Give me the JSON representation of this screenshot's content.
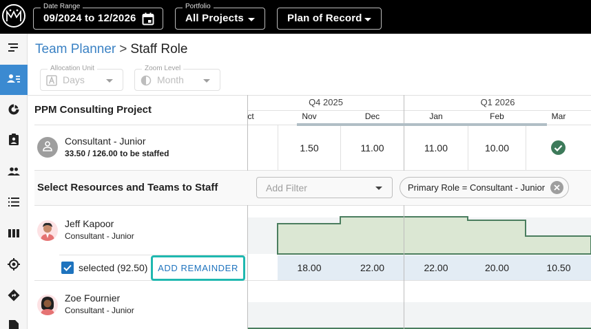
{
  "topbar": {
    "date_range": {
      "legend": "Date Range",
      "value": "09/2024 to 12/2026"
    },
    "portfolio": {
      "legend": "Portfolio",
      "value": "All Projects"
    },
    "plan": {
      "value": "Plan of Record"
    }
  },
  "header": {
    "breadcrumb_link": "Team Planner",
    "breadcrumb_sep": ">",
    "breadcrumb_current": "Staff Role"
  },
  "controls": {
    "allocation_unit": {
      "legend": "Allocation Unit",
      "value": "Days"
    },
    "zoom_level": {
      "legend": "Zoom Level",
      "value": "Month"
    }
  },
  "timeline": {
    "quarters": [
      "Q4 2025",
      "Q1 2026"
    ],
    "partial_month": "ct",
    "months": [
      "Nov",
      "Dec",
      "Jan",
      "Feb",
      "Mar"
    ]
  },
  "project": {
    "title": "PPM Consulting Project",
    "role": "Consultant - Junior",
    "staffing": "33.50 / 126.00 to be staffed",
    "values": [
      "1.50",
      "11.00",
      "11.00",
      "10.00"
    ],
    "mar_status": "check-circle-icon"
  },
  "resources": {
    "title": "Select Resources and Teams to Staff",
    "filter_placeholder": "Add Filter",
    "chip_label": "Primary Role = Consultant - Junior",
    "people": [
      {
        "name": "Jeff Kapoor",
        "role": "Consultant - Junior"
      },
      {
        "name": "Zoe Fournier",
        "role": "Consultant - Junior"
      }
    ],
    "selected_label": "selected (92.50)",
    "add_remainder": "ADD REMAINDER",
    "allocations": [
      "18.00",
      "22.00",
      "22.00",
      "20.00",
      "10.50"
    ]
  },
  "colors": {
    "accent": "#3b8ad1",
    "link": "#3b82c4",
    "highlight": "#1fb8b0",
    "capacity_fill": "#dbe7d3",
    "capacity_line": "#4a7d5e",
    "check": "#3d7a5a"
  }
}
